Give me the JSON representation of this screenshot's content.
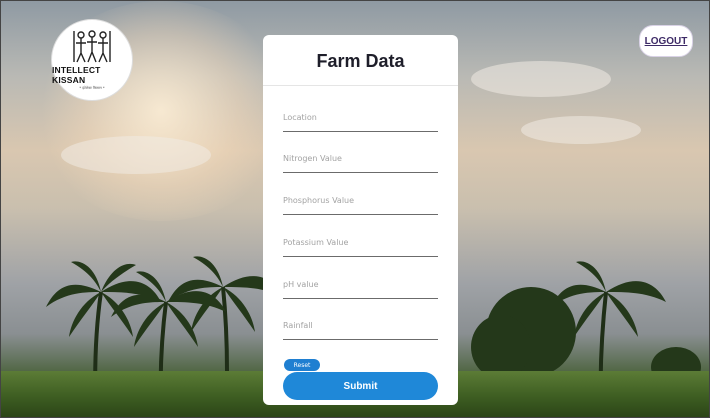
{
  "logo": {
    "title": "INTELLECT KISSAN",
    "tagline": "* इंटेलेक्ट किसान *"
  },
  "header": {
    "logout_label": "LOGOUT"
  },
  "form": {
    "title": "Farm Data",
    "fields": [
      {
        "placeholder": "Location",
        "value": ""
      },
      {
        "placeholder": "Nitrogen Value",
        "value": ""
      },
      {
        "placeholder": "Phosphorus Value",
        "value": ""
      },
      {
        "placeholder": "Potassium Value",
        "value": ""
      },
      {
        "placeholder": "pH value",
        "value": ""
      },
      {
        "placeholder": "Rainfall",
        "value": ""
      }
    ],
    "reset_label": "Reset",
    "submit_label": "Submit"
  },
  "colors": {
    "accent": "#1f88d8",
    "logout_text": "#3d2a66"
  }
}
